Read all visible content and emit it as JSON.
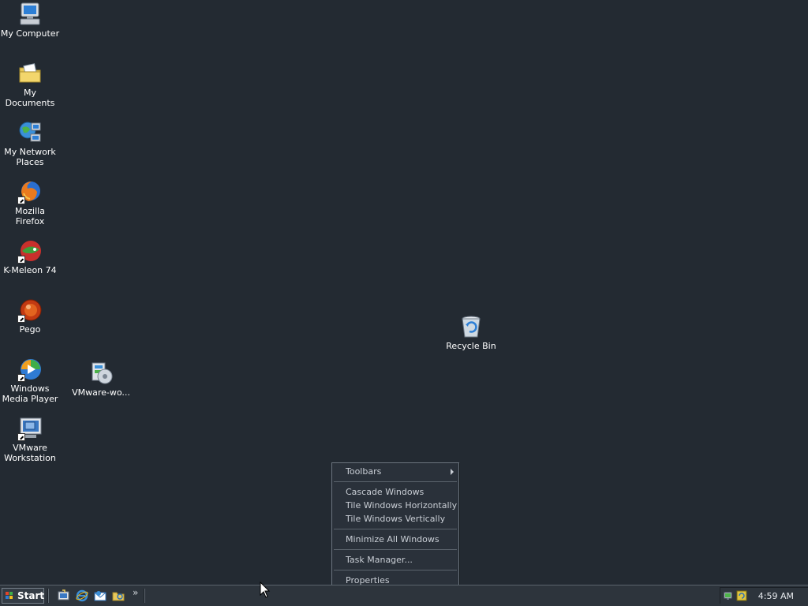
{
  "desktop": {
    "icons": [
      {
        "id": "my-computer",
        "label": "My Computer"
      },
      {
        "id": "my-documents",
        "label": "My Documents"
      },
      {
        "id": "my-network-places",
        "label": "My Network Places"
      },
      {
        "id": "mozilla-firefox",
        "label": "Mozilla Firefox"
      },
      {
        "id": "k-meleon",
        "label": "K-Meleon 74"
      },
      {
        "id": "pego",
        "label": "Pego"
      },
      {
        "id": "windows-media-player",
        "label": "Windows Media Player"
      },
      {
        "id": "vmware-workstation",
        "label": "VMware Workstation"
      },
      {
        "id": "vmware-wo",
        "label": "VMware-wo..."
      },
      {
        "id": "recycle-bin",
        "label": "Recycle Bin"
      }
    ]
  },
  "context_menu": {
    "items": [
      {
        "label": "Toolbars",
        "submenu": true
      },
      {
        "label": "Cascade Windows"
      },
      {
        "label": "Tile Windows Horizontally"
      },
      {
        "label": "Tile Windows Vertically"
      },
      {
        "label": "Minimize All Windows"
      },
      {
        "label": "Task Manager..."
      },
      {
        "label": "Properties"
      }
    ]
  },
  "taskbar": {
    "start_label": "Start",
    "quick_launch": [
      "show-desktop-icon",
      "internet-explorer-icon",
      "outlook-express-icon",
      "explorer-icon"
    ],
    "chevron": "»",
    "clock": "4:59 AM"
  },
  "colors": {
    "desktop_bg": "#232a32",
    "taskbar_bg": "#2d343c",
    "menu_bg": "#2a313a",
    "menu_text": "#c9ced5"
  }
}
